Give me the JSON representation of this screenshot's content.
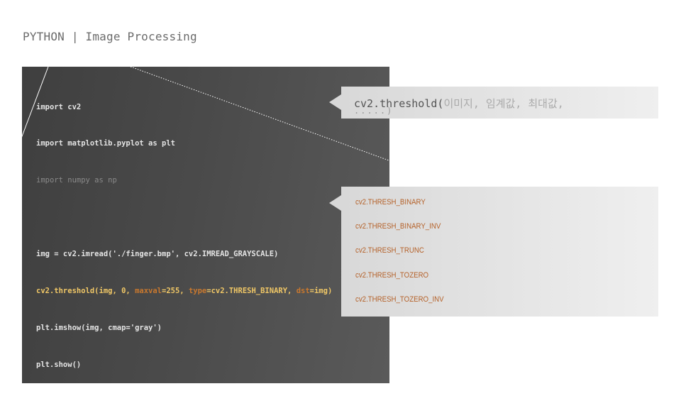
{
  "header": {
    "title": "PYTHON | Image Processing"
  },
  "code": {
    "lines": [
      "import cv2",
      "import matplotlib.pyplot as plt",
      "import numpy as np",
      "",
      "img = cv2.imread('./finger.bmp', cv2.IMREAD_GRAYSCALE)",
      "cv2.threshold(img, 0, maxval=255, type=cv2.THRESH_BINARY, dst=img)",
      "plt.imshow(img, cmap='gray')",
      "plt.show()"
    ],
    "highlight_line": {
      "prefix": "cv2.threshold(img, 0, ",
      "kw1": "maxval",
      "mid1": "=255, ",
      "kw2": "type",
      "mid2": "=cv2.THRESH_BINARY, ",
      "kw3": "dst",
      "suffix": "=img)"
    }
  },
  "signature_callout": {
    "function": "cv2.threshold(",
    "args": "이미지, 임계값, 최대값,",
    "continuation": ".....)"
  },
  "threshold_types": [
    "cv2.THRESH_BINARY",
    "cv2.THRESH_BINARY_INV",
    "cv2.THRESH_TRUNC",
    "cv2.THRESH_TOZERO",
    "cv2.THRESH_TOZERO_INV"
  ],
  "colors": {
    "code_bg": "#4a4a4a",
    "code_text": "#e4e4e4",
    "highlight": "#f0c766",
    "keyword_arg": "#c9782e",
    "type_text": "#b5622a",
    "callout_bg": "#e0e0e0"
  }
}
